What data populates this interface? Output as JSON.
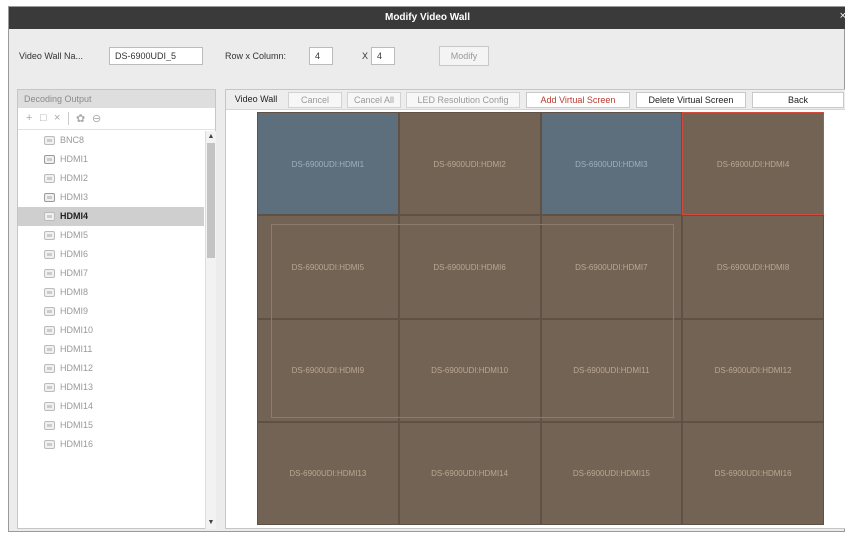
{
  "window": {
    "title": "Modify Video Wall",
    "close_label": "×"
  },
  "form": {
    "name_label": "Video Wall Na...",
    "name_value": "DS-6900UDI_5",
    "rowcol_label": "Row x Column:",
    "rows": "4",
    "x_label": "X",
    "cols": "4",
    "modify_label": "Modify"
  },
  "decoding": {
    "header": "Decoding Output",
    "tools": {
      "add": "+",
      "copy": "□",
      "delete": "×",
      "settings": "✿",
      "link": "⊖"
    },
    "items": [
      "BNC8",
      "HDMI1",
      "HDMI2",
      "HDMI3",
      "HDMI4",
      "HDMI5",
      "HDMI6",
      "HDMI7",
      "HDMI8",
      "HDMI9",
      "HDMI10",
      "HDMI11",
      "HDMI12",
      "HDMI13",
      "HDMI14",
      "HDMI15",
      "HDMI16"
    ],
    "selected": "HDMI4",
    "scroll_up": "▲",
    "scroll_down": "▼"
  },
  "toolbar": {
    "video_wall": "Video Wall",
    "cancel": "Cancel",
    "cancel_all": "Cancel All",
    "led_config": "LED Resolution Config",
    "add_virtual": "Add Virtual Screen",
    "delete_virtual": "Delete Virtual Screen",
    "back": "Back"
  },
  "wall": {
    "cells": [
      "DS-6900UDI:HDMI1",
      "DS-6900UDI:HDMI2",
      "DS-6900UDI:HDMI3",
      "DS-6900UDI:HDMI4",
      "DS-6900UDI:HDMI5",
      "DS-6900UDI:HDMI6",
      "DS-6900UDI:HDMI7",
      "DS-6900UDI:HDMI8",
      "DS-6900UDI:HDMI9",
      "DS-6900UDI:HDMI10",
      "DS-6900UDI:HDMI11",
      "DS-6900UDI:HDMI12",
      "DS-6900UDI:HDMI13",
      "DS-6900UDI:HDMI14",
      "DS-6900UDI:HDMI15",
      "DS-6900UDI:HDMI16"
    ],
    "blue_cells": [
      0,
      2
    ],
    "selected_cell": 3,
    "colors": {
      "blue": "#5d6e7c",
      "brown": "#736354",
      "selected_border": "#d24a3c"
    }
  }
}
